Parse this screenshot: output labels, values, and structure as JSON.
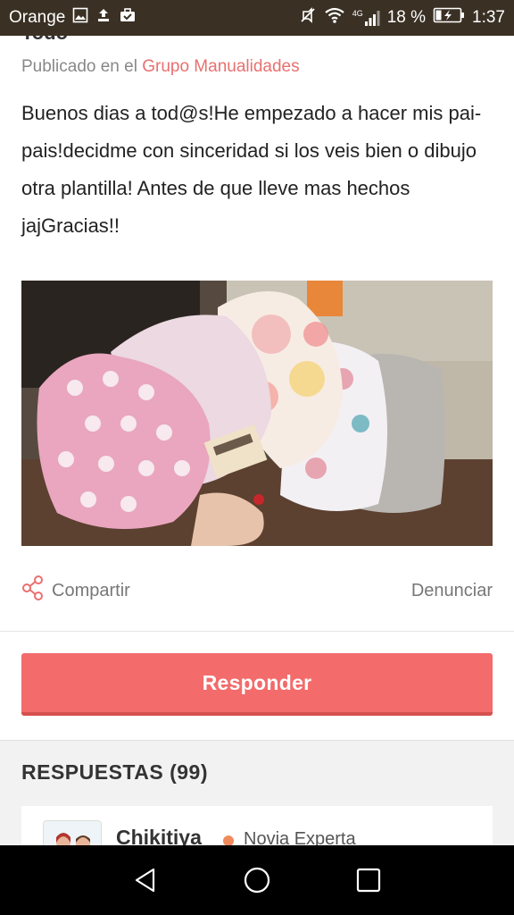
{
  "status_bar": {
    "carrier": "Orange",
    "battery_percent": "18 %",
    "time": "1:37",
    "network": "4G",
    "icons": [
      "image-icon",
      "upload-icon",
      "briefcase-check-icon",
      "mute-vibrate-icon",
      "wifi-icon",
      "signal-icon",
      "battery-charging-icon"
    ]
  },
  "post": {
    "title_cut": "Todo",
    "published_prefix": "Publicado en el ",
    "group_name": "Grupo Manualidades",
    "body": "Buenos dias a tod@s!He empezado a hacer mis pai-pais!decidme con sinceridad si los veis bien o dibujo otra plantilla! Antes de que lleve mas hechos jajGracias!!"
  },
  "actions": {
    "share_label": "Compartir",
    "report_label": "Denunciar"
  },
  "reply_button": {
    "label": "Responder",
    "color": "#f36b6b"
  },
  "answers": {
    "title": "RESPUESTAS (99)",
    "first": {
      "user": "Chikitiya",
      "rank": "Novia Experta",
      "rank_color": "#f08a5d"
    }
  },
  "nav": {
    "icons": [
      "back-icon",
      "home-icon",
      "recents-icon"
    ]
  },
  "colors": {
    "accent": "#e9706f",
    "status_bar": "#3a3024"
  }
}
